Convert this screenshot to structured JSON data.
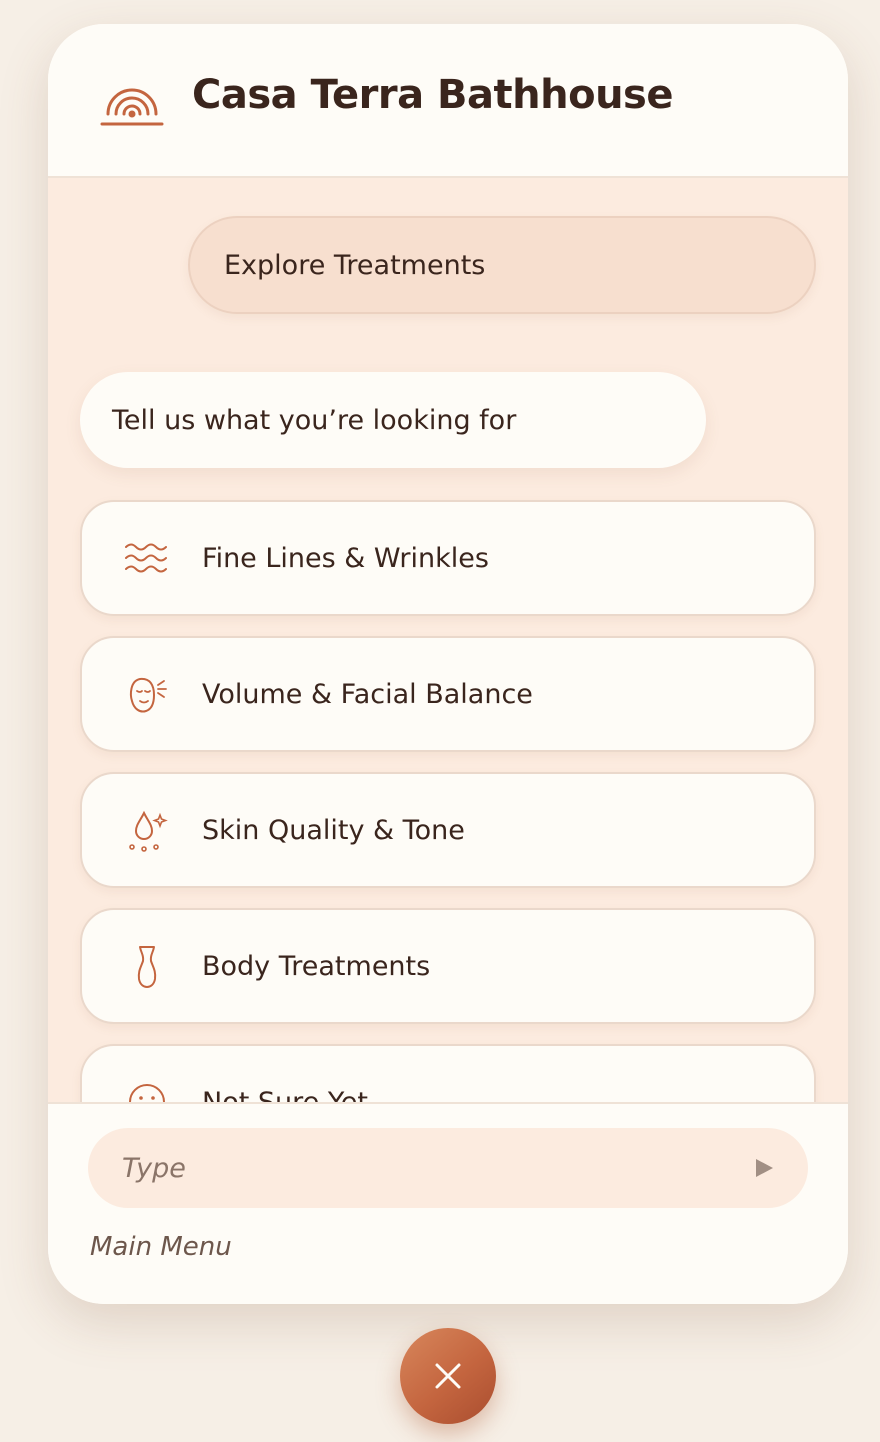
{
  "header": {
    "title": "Casa Terra Bathhouse",
    "logo_icon": "sunrise-arch-icon"
  },
  "chat": {
    "user_message": "Explore Treatments",
    "bot_message": "Tell us what you’re looking for",
    "options": [
      {
        "label": "Fine Lines & Wrinkles",
        "icon": "waves-icon"
      },
      {
        "label": "Volume & Facial Balance",
        "icon": "face-icon"
      },
      {
        "label": "Skin Quality & Tone",
        "icon": "droplet-sparkle-icon"
      },
      {
        "label": "Body Treatments",
        "icon": "body-silhouette-icon"
      },
      {
        "label": "Not Sure Yet",
        "icon": "unsure-face-icon"
      }
    ]
  },
  "composer": {
    "placeholder": "Type",
    "send_icon": "send-triangle-icon"
  },
  "footer": {
    "main_menu_label": "Main Menu"
  },
  "fab": {
    "icon": "close-icon"
  },
  "colors": {
    "accent": "#c4653f",
    "text": "#3a251d",
    "panel": "#fefcf7",
    "chat_bg": "#fcebdf",
    "user_bubble": "#f7dfcf",
    "page_bg": "#f6efe6"
  }
}
